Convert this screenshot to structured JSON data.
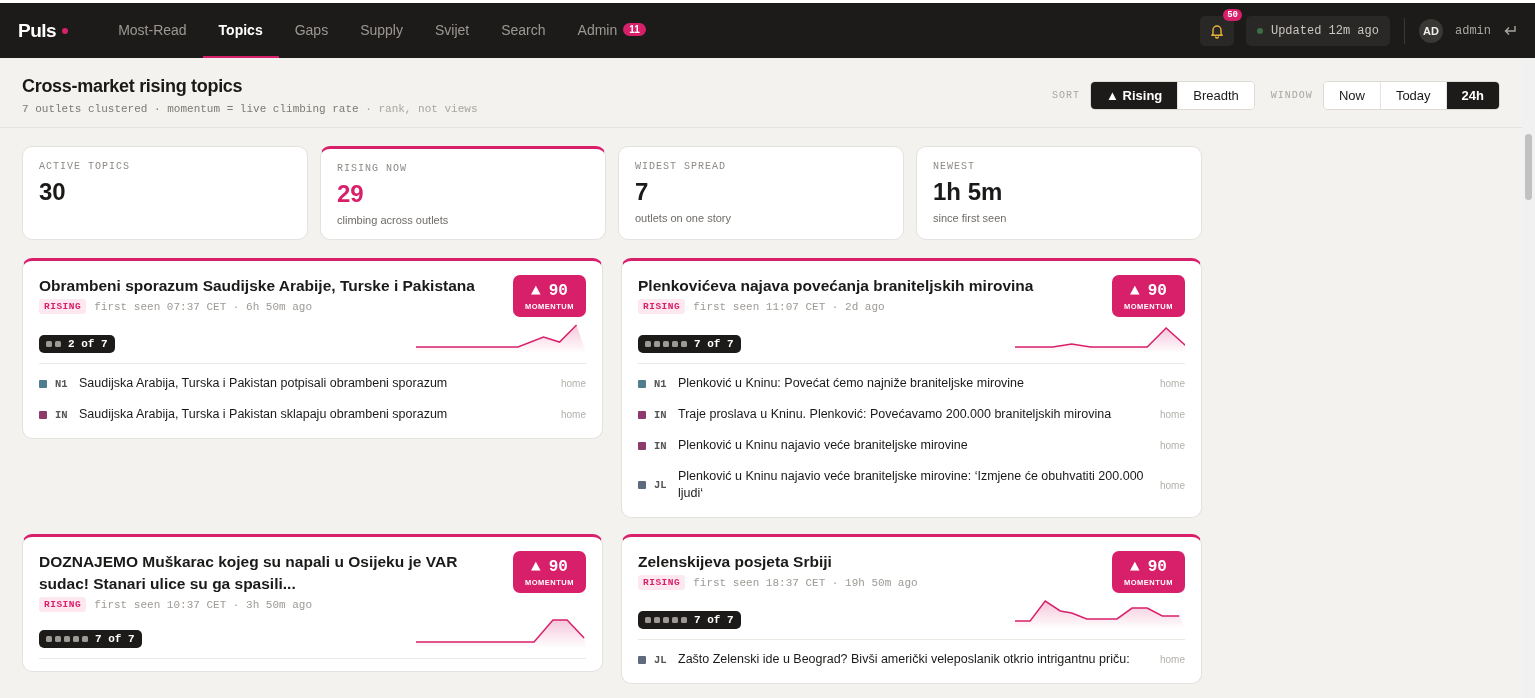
{
  "brand": {
    "name": "Puls"
  },
  "nav": [
    {
      "label": "Most-Read",
      "selected": false
    },
    {
      "label": "Topics",
      "selected": true
    },
    {
      "label": "Gaps",
      "selected": false
    },
    {
      "label": "Supply",
      "selected": false
    },
    {
      "label": "Svijet",
      "selected": false
    },
    {
      "label": "Search",
      "selected": false
    },
    {
      "label": "Admin",
      "selected": false,
      "badge": "11"
    }
  ],
  "notifications": {
    "count": "50"
  },
  "status": {
    "text": "Updated 12m ago"
  },
  "user": {
    "initials": "AD",
    "name": "admin"
  },
  "page": {
    "title": "Cross-market rising topics",
    "subtitle": "7 outlets clustered · momentum = live climbing rate",
    "note": "· rank, not views"
  },
  "sort": {
    "label": "SORT",
    "options": [
      {
        "label": "▲ Rising",
        "selected": true
      },
      {
        "label": "Breadth",
        "selected": false
      }
    ]
  },
  "window": {
    "label": "WINDOW",
    "options": [
      {
        "label": "Now",
        "selected": false
      },
      {
        "label": "Today",
        "selected": false
      },
      {
        "label": "24h",
        "selected": true
      }
    ]
  },
  "stats": [
    {
      "label": "ACTIVE TOPICS",
      "value": "30",
      "highlighted": false
    },
    {
      "label": "RISING NOW",
      "value": "29",
      "caption": "climbing across outlets",
      "highlighted": true
    },
    {
      "label": "WIDEST SPREAD",
      "value": "7",
      "caption": "outlets on one story",
      "highlighted": false
    },
    {
      "label": "NEWEST",
      "value": "1h 5m",
      "caption": "since first seen",
      "highlighted": false
    }
  ],
  "topics": [
    {
      "title": "Obrambeni sporazum Saudijske Arabije, Turske i Pakistana",
      "status": "RISING",
      "meta": "first seen 07:37 CET · 6h 50m ago",
      "trend": "▲",
      "momentum": "90",
      "momentum_label": "MOMENTUM",
      "coverage": "2 of 7",
      "stories": [
        {
          "source": "N1",
          "color": "#4f7f8f",
          "headline": "Saudijska Arabija, Turska i Pakistan potpisali obrambeni sporazum",
          "section": "home"
        },
        {
          "source": "IN",
          "color": "#8c3b6c",
          "headline": "Saudijska Arabija, Turska i Pakistan sklapaju obrambeni sporazum",
          "section": "home"
        }
      ]
    },
    {
      "title": "Plenkovićeva najava povećanja braniteljskih mirovina",
      "status": "RISING",
      "meta": "first seen 11:07 CET · 2d ago",
      "trend": "▲",
      "momentum": "90",
      "momentum_label": "MOMENTUM",
      "coverage": "7 of 7",
      "stories": [
        {
          "source": "N1",
          "color": "#4f7f8f",
          "headline": "Plenković u Kninu: Povećat ćemo najniže braniteljske mirovine",
          "section": "home"
        },
        {
          "source": "IN",
          "color": "#8c3b6c",
          "headline": "Traje proslava u Kninu. Plenković: Povećavamo 200.000 braniteljskih mirovina",
          "section": "home"
        },
        {
          "source": "IN",
          "color": "#8c3b6c",
          "headline": "Plenković u Kninu najavio veće braniteljske mirovine",
          "section": "home"
        },
        {
          "source": "JL",
          "color": "#5d6b7c",
          "headline": "Plenković u Kninu najavio veće braniteljske mirovine: ‘Izmjene će obuhvatiti 200.000 ljudi‘",
          "section": "home"
        }
      ]
    },
    {
      "title": "DOZNAJEMO Muškarac kojeg su napali u Osijeku je VAR sudac! Stanari ulice su ga spasili...",
      "status": "RISING",
      "meta": "first seen 10:37 CET · 3h 50m ago",
      "trend": "▲",
      "momentum": "90",
      "momentum_label": "MOMENTUM",
      "coverage": "7 of 7"
    },
    {
      "title": "Zelenskijeva posjeta Srbiji",
      "status": "RISING",
      "meta": "first seen 18:37 CET · 19h 50m ago",
      "trend": "▲",
      "momentum": "90",
      "momentum_label": "MOMENTUM",
      "coverage": "7 of 7",
      "stories": [
        {
          "source": "JL",
          "color": "#5d6b7c",
          "headline": "Zašto Zelenski ide u Beograd? Bivši američki veleposlanik otkrio intrigantnu priču:",
          "section": "home"
        }
      ]
    }
  ]
}
